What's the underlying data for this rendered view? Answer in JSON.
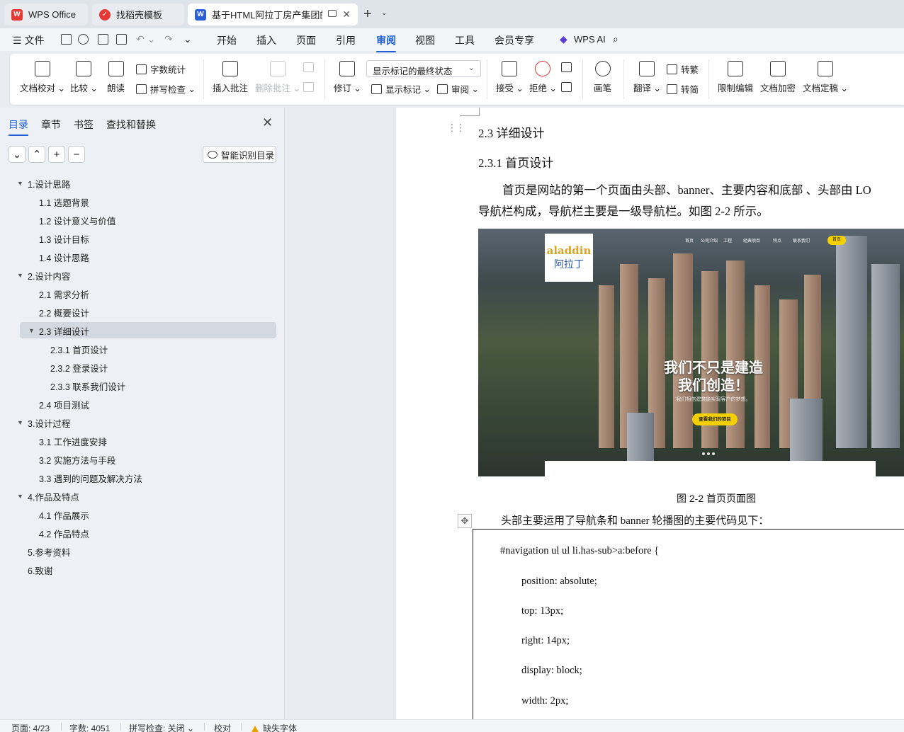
{
  "tabs": [
    {
      "label": "WPS Office",
      "color": "#e53935"
    },
    {
      "label": "找稻壳模板",
      "color": "#e53935"
    },
    {
      "label": "基于HTML阿拉丁房产集团的网",
      "color": "#2b5fd9"
    }
  ],
  "menu": {
    "file": "文件",
    "items": [
      "开始",
      "插入",
      "页面",
      "引用",
      "审阅",
      "视图",
      "工具",
      "会员专享"
    ],
    "active": "审阅",
    "wps_ai": "WPS AI"
  },
  "ribbon": {
    "proofread": "文档校对",
    "compare": "比较",
    "read_aloud": "朗读",
    "word_count": "字数统计",
    "spell_check": "拼写检查",
    "insert_comment": "插入批注",
    "delete_comment": "删除批注",
    "track_changes": "修订",
    "markup_state": "显示标记的最终状态",
    "show_markup": "显示标记",
    "review": "审阅",
    "accept": "接受",
    "reject": "拒绝",
    "pen": "画笔",
    "translate": "翻译",
    "to_traditional": "转繁",
    "to_simplified": "转简",
    "restrict_edit": "限制编辑",
    "encrypt": "文档加密",
    "finalize": "文档定稿"
  },
  "sidebar": {
    "tabs": [
      "目录",
      "章节",
      "书签",
      "查找和替换"
    ],
    "smart_toc": "智能识别目录",
    "toc": [
      {
        "label": "1.设计思路",
        "level": 1,
        "expanded": true
      },
      {
        "label": "1.1 选题背景",
        "level": 2
      },
      {
        "label": "1.2 设计意义与价值",
        "level": 2
      },
      {
        "label": "1.3 设计目标",
        "level": 2
      },
      {
        "label": "1.4 设计思路",
        "level": 2
      },
      {
        "label": "2.设计内容",
        "level": 1,
        "expanded": true
      },
      {
        "label": "2.1 需求分析",
        "level": 2
      },
      {
        "label": "2.2 概要设计",
        "level": 2
      },
      {
        "label": "2.3 详细设计",
        "level": 2,
        "expanded": true,
        "selected": true
      },
      {
        "label": "2.3.1 首页设计",
        "level": 3
      },
      {
        "label": "2.3.2 登录设计",
        "level": 3
      },
      {
        "label": "2.3.3 联系我们设计",
        "level": 3
      },
      {
        "label": "2.4 项目测试",
        "level": 2
      },
      {
        "label": "3.设计过程",
        "level": 1,
        "expanded": true
      },
      {
        "label": "3.1 工作进度安排",
        "level": 2
      },
      {
        "label": "3.2 实施方法与手段",
        "level": 2
      },
      {
        "label": "3.3 遇到的问题及解决方法",
        "level": 2
      },
      {
        "label": "4.作品及特点",
        "level": 1,
        "expanded": true
      },
      {
        "label": "4.1 作品展示",
        "level": 2
      },
      {
        "label": "4.2 作品特点",
        "level": 2
      },
      {
        "label": "5.参考资料",
        "level": 1
      },
      {
        "label": "6.致谢",
        "level": 1
      }
    ]
  },
  "document": {
    "heading_23": "2.3 详细设计",
    "heading_231": "2.3.1 首页设计",
    "para_line1": "首页是网站的第一个页面由头部、banner、主要内容和底部 、头部由 LO",
    "para_line2": "导航栏构成，导航栏主要是一级导航栏。如图  2-2  所示。",
    "figure": {
      "logo_en": "aladdin",
      "logo_cn": "阿拉丁",
      "nav": [
        "首页",
        "公司介绍",
        "工程",
        "经典项目",
        "特点",
        "联系我们"
      ],
      "nav_button": "首页",
      "headline1": "我们不只是建造",
      "headline2": "我们创造！",
      "subline": "我们相信建筑能实现客户的梦想。",
      "cta": "查看我们的项目"
    },
    "caption": "图 2-2 首页页面图",
    "intro": "头部主要运用了导航条和 banner 轮播图的主要代码见下：",
    "code": [
      "#navigation ul ul li.has-sub>a:before {",
      "position: absolute;",
      "top: 13px;",
      "right: 14px;",
      "display: block;",
      "width: 2px;"
    ]
  },
  "status": {
    "page": "页面: 4/23",
    "words": "字数: 4051",
    "spell": "拼写检查: 关闭",
    "proof": "校对",
    "missing_font": "缺失字体"
  }
}
